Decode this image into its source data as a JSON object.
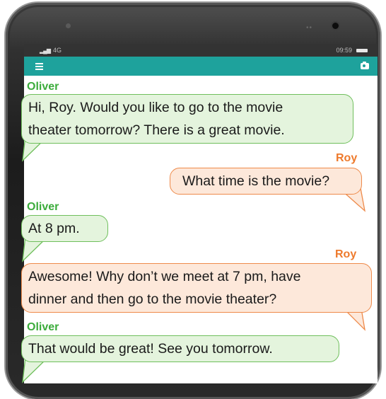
{
  "status_bar": {
    "network": "4G",
    "time": "09:59"
  },
  "app_bar": {
    "menu_icon": "hamburger-menu-icon",
    "camera_icon": "camera-icon"
  },
  "colors": {
    "app_bar": "#1ea29c",
    "oliver_name": "#3cac3c",
    "roy_name": "#ee7a2c",
    "oliver_bubble_fill": "#e4f4dd",
    "oliver_bubble_border": "#6fbf5c",
    "roy_bubble_fill": "#fde8da",
    "roy_bubble_border": "#ee8a4a"
  },
  "messages": [
    {
      "sender": "Oliver",
      "line1": "Hi, Roy. Would you like to go to the movie",
      "line2": "theater tomorrow? There is a great movie."
    },
    {
      "sender": "Roy",
      "line1": "What time is the movie?"
    },
    {
      "sender": "Oliver",
      "line1": "At 8 pm."
    },
    {
      "sender": "Roy",
      "line1": "Awesome! Why don’t we meet at 7 pm, have",
      "line2": "dinner and then go to the movie theater?"
    },
    {
      "sender": "Oliver",
      "line1": "That would be great! See you tomorrow."
    }
  ]
}
